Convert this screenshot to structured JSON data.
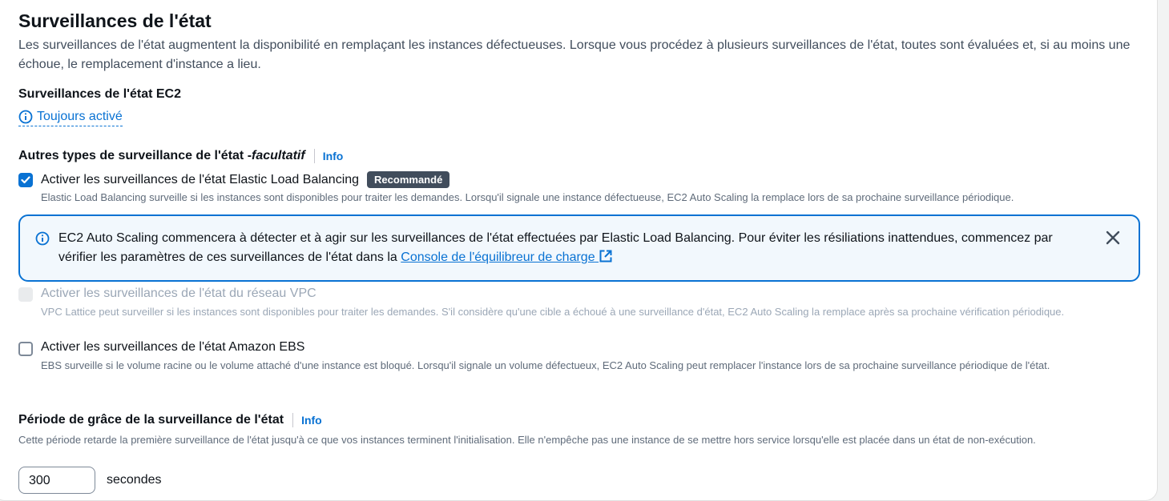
{
  "section": {
    "title": "Surveillances de l'état",
    "description": "Les surveillances de l'état augmentent la disponibilité en remplaçant les instances défectueuses. Lorsque vous procédez à plusieurs surveillances de l'état, toutes sont évaluées et, si au moins une échoue, le remplacement d'instance a lieu."
  },
  "ec2": {
    "heading": "Surveillances de l'état EC2",
    "always_on": "Toujours activé"
  },
  "other_types": {
    "heading": "Autres types de surveillance de l'état - ",
    "optional": "facultatif",
    "info": "Info",
    "options": [
      {
        "label": "Activer les surveillances de l'état Elastic Load Balancing",
        "badge": "Recommandé",
        "checked": true,
        "disabled": false,
        "description": "Elastic Load Balancing surveille si les instances sont disponibles pour traiter les demandes. Lorsqu'il signale une instance défectueuse, EC2 Auto Scaling la remplace lors de sa prochaine surveillance périodique."
      },
      {
        "label": "Activer les surveillances de l'état du réseau VPC",
        "checked": false,
        "disabled": true,
        "description": "VPC Lattice peut surveiller si les instances sont disponibles pour traiter les demandes. S'il considère qu'une cible a échoué à une surveillance d'état, EC2 Auto Scaling la remplace après sa prochaine vérification périodique."
      },
      {
        "label": "Activer les surveillances de l'état Amazon EBS",
        "checked": false,
        "disabled": false,
        "description": "EBS surveille si le volume racine ou le volume attaché d'une instance est bloqué. Lorsqu'il signale un volume défectueux, EC2 Auto Scaling peut remplacer l'instance lors de sa prochaine surveillance périodique de l'état."
      }
    ]
  },
  "alert": {
    "text": "EC2 Auto Scaling commencera à détecter et à agir sur les surveillances de l'état effectuées par Elastic Load Balancing. Pour éviter les résiliations inattendues, commencez par vérifier les paramètres de ces surveillances de l'état dans la ",
    "link": "Console de l'équilibreur de charge"
  },
  "grace_period": {
    "heading": "Période de grâce de la surveillance de l'état",
    "info": "Info",
    "description": "Cette période retarde la première surveillance de l'état jusqu'à ce que vos instances terminent l'initialisation. Elle n'empêche pas une instance de se mettre hors service lorsqu'elle est placée dans un état de non-exécution.",
    "value": "300",
    "unit": "secondes"
  },
  "colors": {
    "accent": "#0972d3",
    "text": "#0f141a",
    "muted": "#5f6b7a",
    "disabled": "#9ba7b6",
    "badge_bg": "#414d5c",
    "alert_bg": "#f2f8fd"
  }
}
